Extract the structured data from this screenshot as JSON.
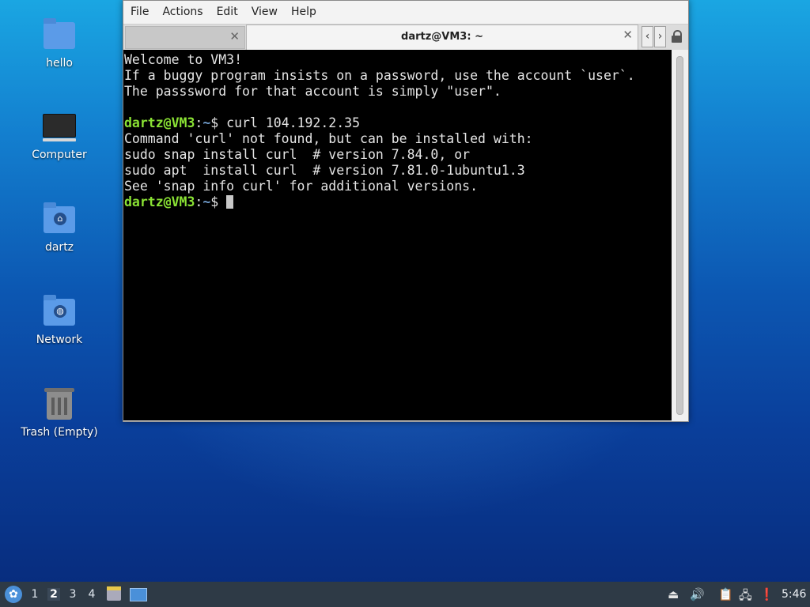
{
  "desktop": {
    "icons": [
      {
        "label": "hello",
        "icon": "folder-icon"
      },
      {
        "label": "Computer",
        "icon": "computer-icon"
      },
      {
        "label": "dartz",
        "icon": "home-folder-icon"
      },
      {
        "label": "Network",
        "icon": "network-folder-icon"
      },
      {
        "label": "Trash (Empty)",
        "icon": "trash-icon"
      }
    ]
  },
  "terminal": {
    "menu": [
      "File",
      "Actions",
      "Edit",
      "View",
      "Help"
    ],
    "tab_title": "dartz@VM3: ~",
    "lines": [
      "Welcome to VM3!",
      "If a buggy program insists on a password, use the account `user`.",
      "The passsword for that account is simply \"user\".",
      "",
      "Command 'curl' not found, but can be installed with:",
      "sudo snap install curl  # version 7.84.0, or",
      "sudo apt  install curl  # version 7.81.0-1ubuntu1.3",
      "See 'snap info curl' for additional versions."
    ],
    "prompt_user": "dartz@VM3",
    "prompt_sep": ":",
    "prompt_path": "~",
    "prompt_symbol": "$",
    "command": " curl 104.192.2.35"
  },
  "taskbar": {
    "workspaces": [
      "1",
      "2",
      "3",
      "4"
    ],
    "active_workspace": "2",
    "clock": "5:46"
  }
}
